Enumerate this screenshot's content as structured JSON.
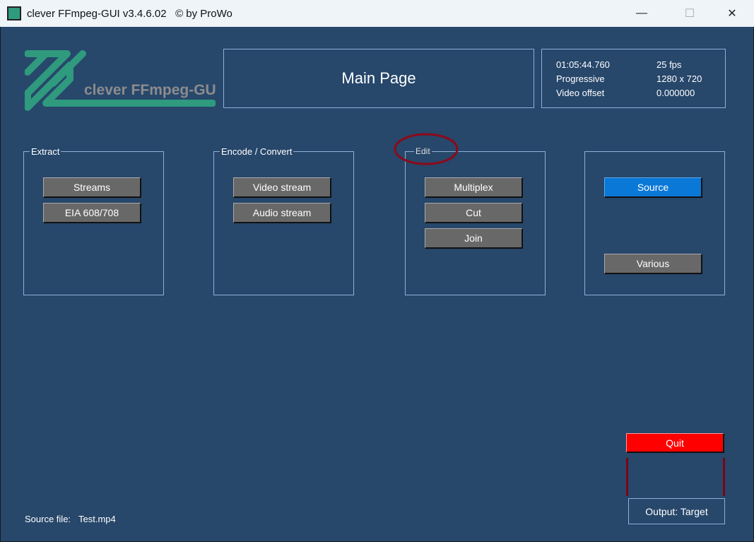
{
  "window": {
    "title": "clever FFmpeg-GUI v3.4.6.02   © by ProWo",
    "minimize": "—",
    "maximize": "☐",
    "close": "✕"
  },
  "logo": {
    "text": "clever FFmpeg-GUI"
  },
  "header": {
    "title": "Main Page"
  },
  "info": {
    "duration": "01:05:44.760",
    "fps": "25 fps",
    "scan": "Progressive",
    "resolution": "1280 x 720",
    "offset_label": "Video offset",
    "offset_value": "0.000000"
  },
  "groups": {
    "extract": {
      "label": "Extract",
      "buttons": [
        "Streams",
        "EIA 608/708"
      ]
    },
    "encode": {
      "label": "Encode / Convert",
      "buttons": [
        "Video stream",
        "Audio stream"
      ]
    },
    "edit": {
      "label": "Edit",
      "buttons": [
        "Multiplex",
        "Cut",
        "Join"
      ]
    },
    "misc": {
      "buttons": [
        "Source",
        "Various"
      ]
    }
  },
  "quit": "Quit",
  "output": "Output: Target",
  "source": {
    "label": "Source file:",
    "value": "Test.mp4"
  },
  "colors": {
    "bg": "#27476b",
    "accent": "#0a78d7",
    "quit": "#ff0000",
    "logo": "#2f9a7e"
  }
}
